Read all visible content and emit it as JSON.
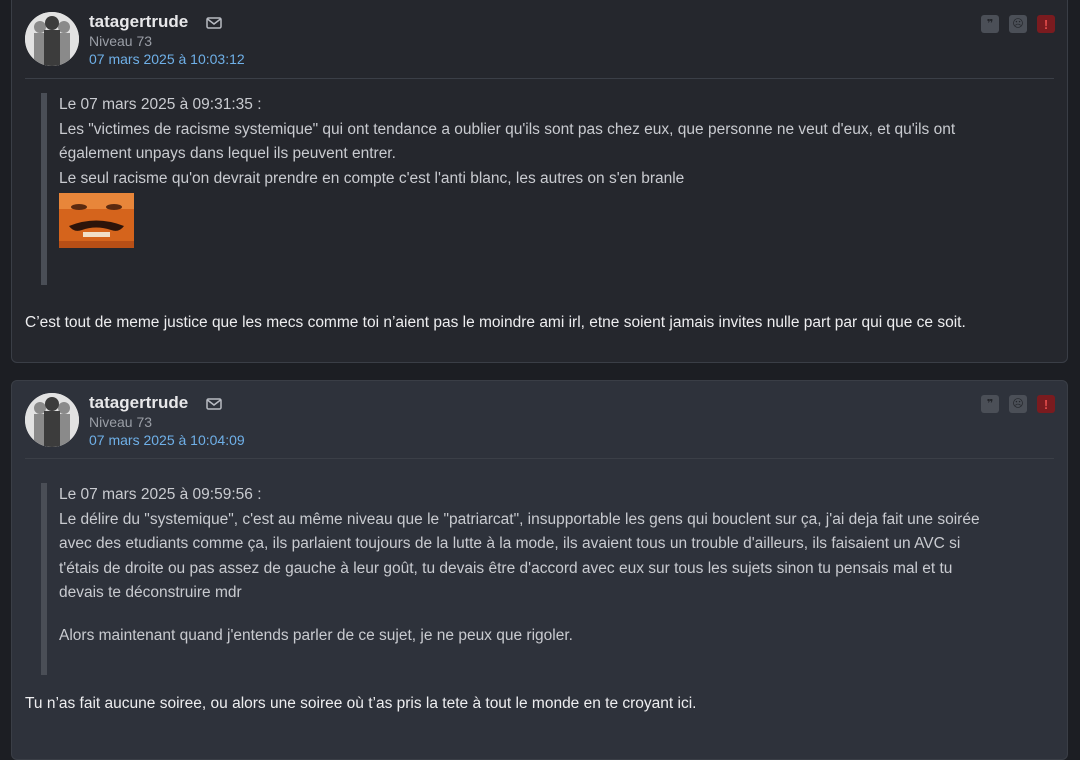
{
  "posts": [
    {
      "author": "tatagertrude",
      "level": "Niveau 73",
      "date": "07 mars 2025 à 10:03:12",
      "quote": {
        "header": "Le 07 mars 2025 à 09:31:35 :",
        "lines": [
          "Les \"victimes de racisme systemique\" qui ont tendance a oublier qu'ils sont pas chez eux, que personne ne veut d'eux, et qu'ils ont",
          "également unpays dans lequel ils peuvent entrer.",
          "Le seul racisme qu'on devrait prendre en compte c'est l'anti blanc, les autres on s'en branle"
        ],
        "image": "risitas-smiley"
      },
      "reply": "C’est tout de meme justice que les mecs comme toi n’aient pas le moindre ami irl, etne soient jamais invites nulle part par qui que ce soit."
    },
    {
      "author": "tatagertrude",
      "level": "Niveau 73",
      "date": "07 mars 2025 à 10:04:09",
      "quote": {
        "header": "Le 07 mars 2025 à 09:59:56 :",
        "lines": [
          "Le délire du \"systemique\", c'est au même niveau que le \"patriarcat\", insupportable les gens qui bouclent sur ça, j'ai deja fait une soirée",
          "avec des etudiants comme ça, ils parlaient toujours de la lutte à la mode, ils avaient tous un trouble d'ailleurs, ils faisaient un AVC si",
          "t'étais de droite ou pas assez de gauche à leur goût, tu devais être d'accord avec eux sur tous les sujets sinon tu pensais mal et tu",
          "devais te déconstruire mdr"
        ],
        "paragraph2": "Alors maintenant quand j'entends parler de ce sujet, je ne peux que rigoler."
      },
      "reply": "Tu n’as fait aucune soiree, ou alors une soiree où t’as pris la tete à tout le monde en te croyant ici."
    }
  ],
  "actions": {
    "quote_icon": "quote-icon",
    "quote_glyph": "❞",
    "sad_icon": "sad-face-icon",
    "sad_glyph": "☹",
    "alert_icon": "alert-icon",
    "alert_glyph": "!"
  },
  "colors": {
    "background": "#1c1e23",
    "post1_bg": "#25272d",
    "post2_bg": "#2e323b",
    "date_link": "#6fb0e8",
    "alert_red": "#7a1b1f"
  }
}
